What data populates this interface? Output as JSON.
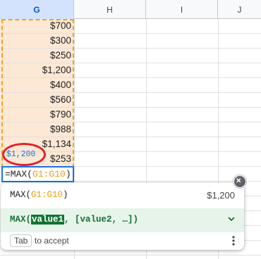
{
  "columns": [
    "G",
    "H",
    "I",
    "J"
  ],
  "column_g_values": [
    "$700",
    "$300",
    "$250",
    "$1,200",
    "$400",
    "$560",
    "$790",
    "$988",
    "$1,134",
    "$253"
  ],
  "preview_value": "$1,200",
  "formula": {
    "prefix": "=MAX(",
    "range": "G1:G10",
    "suffix": ")"
  },
  "autocomplete": {
    "suggestion_fn": "MAX(",
    "suggestion_range": "G1:G10",
    "suggestion_close": ")",
    "suggestion_value": "$1,200",
    "help_fn": "MAX(",
    "help_param": "value1",
    "help_rest": ", [value2, …])",
    "tab_key": "Tab",
    "accept_text": "to accept"
  },
  "colors": {
    "range_highlight": "#f0a21d",
    "active_border": "#1a73e8",
    "annotation_circle": "#e0232a",
    "help_bg": "#e6f4ea"
  }
}
